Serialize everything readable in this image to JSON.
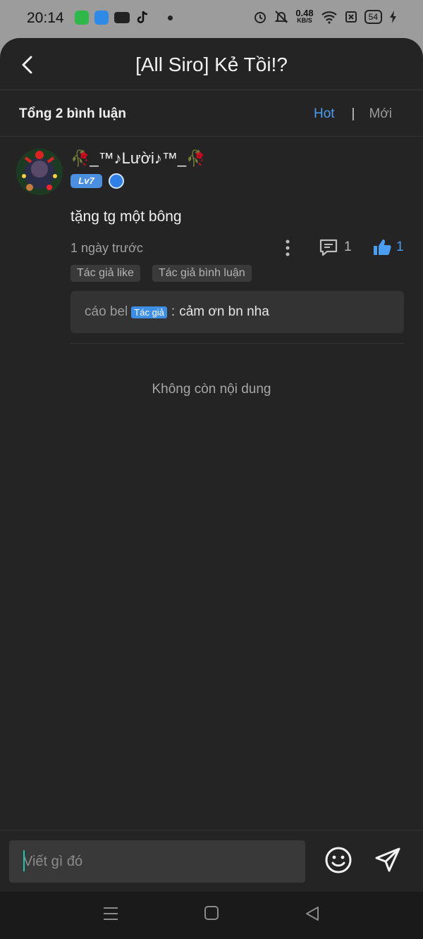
{
  "status": {
    "time": "20:14",
    "net_speed": "0.48",
    "net_unit": "KB/S",
    "battery": "54"
  },
  "header": {
    "title": "[All Siro] Kẻ Tồi!?"
  },
  "summary": {
    "total": "Tổng 2 bình luận",
    "sort_hot": "Hot",
    "sort_separator": "|",
    "sort_new": "Mới"
  },
  "comment": {
    "username": "🥀_™♪Lười♪™_🥀",
    "level": "Lv7",
    "text": "tặng tg một bông",
    "time": "1 ngày trước",
    "reply_count": "1",
    "like_count": "1",
    "tags": [
      "Tác giả like",
      "Tác giả bình luận"
    ],
    "reply": {
      "author": "cáo bel",
      "badge": "Tác giả",
      "separator": ":",
      "text": "cảm ơn bn nha"
    }
  },
  "footer_note": "Không còn nội dung",
  "input": {
    "placeholder": "Viết gì đó"
  },
  "colors": {
    "accent": "#4a9df0",
    "background": "#242424",
    "caret": "#1ec7a6"
  },
  "icons": {
    "back": "chevron-left-icon",
    "more": "more-vertical-icon",
    "reply": "comment-icon",
    "like": "thumbs-up-icon",
    "emoji": "smile-icon",
    "send": "send-icon"
  }
}
